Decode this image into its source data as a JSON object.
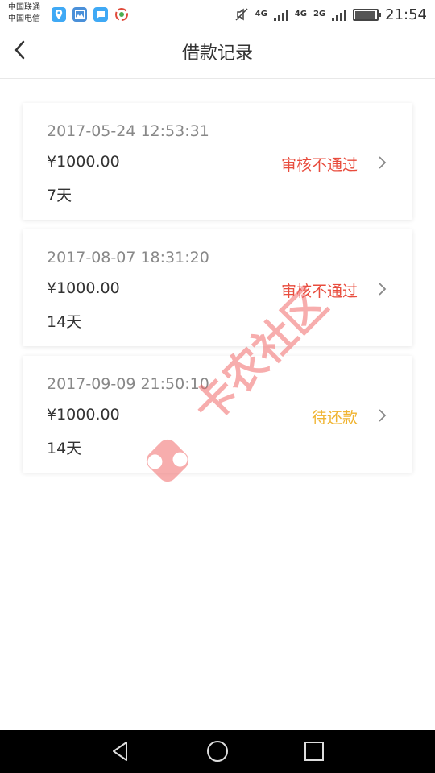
{
  "status_bar": {
    "carrier_1": "中国联通",
    "carrier_2": "中国电信",
    "net_1": "4G",
    "net_2": "4G",
    "net_3": "2G",
    "time": "21:54",
    "notification_icons": [
      "map-pin-icon",
      "gallery-icon",
      "chat-icon",
      "app-icon"
    ]
  },
  "header": {
    "title": "借款记录",
    "back_icon": "chevron-left-icon"
  },
  "records": [
    {
      "time": "2017-05-24 12:53:31",
      "amount": "¥1000.00",
      "term": "7天",
      "status": "审核不通过",
      "status_color": "#e84c3d"
    },
    {
      "time": "2017-08-07 18:31:20",
      "amount": "¥1000.00",
      "term": "14天",
      "status": "审核不通过",
      "status_color": "#e84c3d"
    },
    {
      "time": "2017-09-09 21:50:10",
      "amount": "¥1000.00",
      "term": "14天",
      "status": "待还款",
      "status_color": "#f0b431"
    }
  ],
  "watermark": {
    "text": "卡农社区",
    "color": "#f26b6b"
  },
  "nav_bar": {
    "icons": [
      "back-triangle-icon",
      "home-circle-icon",
      "recents-square-icon"
    ]
  }
}
